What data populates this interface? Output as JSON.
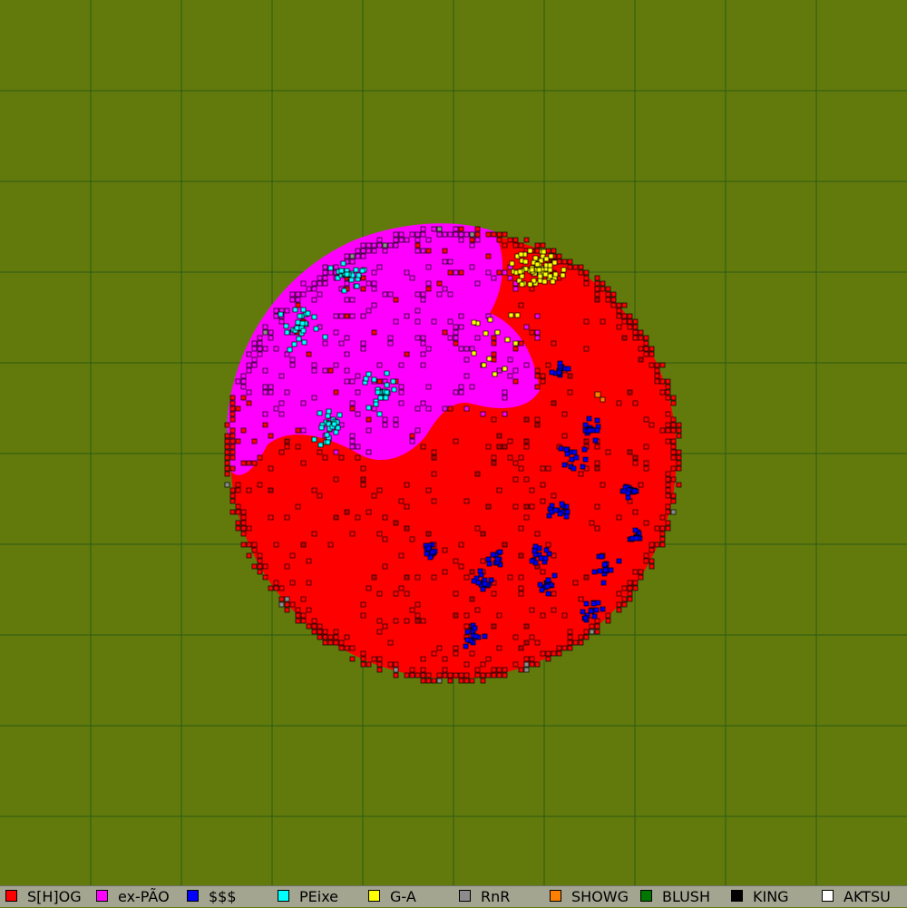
{
  "map": {
    "background_color": "#627a0c",
    "grid_color": "#2c5a14"
  },
  "territories": [
    {
      "team": "S[H]OG",
      "color": "#ff0000",
      "area": "dominant; southern, eastern and central parts of the circular world"
    },
    {
      "team": "ex-PÃO",
      "color": "#ff00ff",
      "area": "north-west quadrant"
    },
    {
      "team": "$$$",
      "color": "#0000ff",
      "area": "scattered clusters in the south-east"
    },
    {
      "team": "PEixe",
      "color": "#00ffff",
      "area": "small clusters in the west"
    },
    {
      "team": "G-A",
      "color": "#ffff00",
      "area": "cluster in the north"
    }
  ],
  "legend": {
    "items": [
      {
        "name": "S[H]OG",
        "color": "#ff0000"
      },
      {
        "name": "ex-PÃO",
        "color": "#ff00ff"
      },
      {
        "name": "$$$",
        "color": "#0000ff"
      },
      {
        "name": "PEixe",
        "color": "#00ffff"
      },
      {
        "name": "G-A",
        "color": "#ffff00"
      },
      {
        "name": "RnR",
        "color": "#8c8c8c"
      },
      {
        "name": "SHOWG",
        "color": "#ff7f00"
      },
      {
        "name": "BLUSH",
        "color": "#007700"
      },
      {
        "name": "KING",
        "color": "#000000"
      },
      {
        "name": "AKTSU",
        "color": "#ffffff"
      }
    ]
  }
}
